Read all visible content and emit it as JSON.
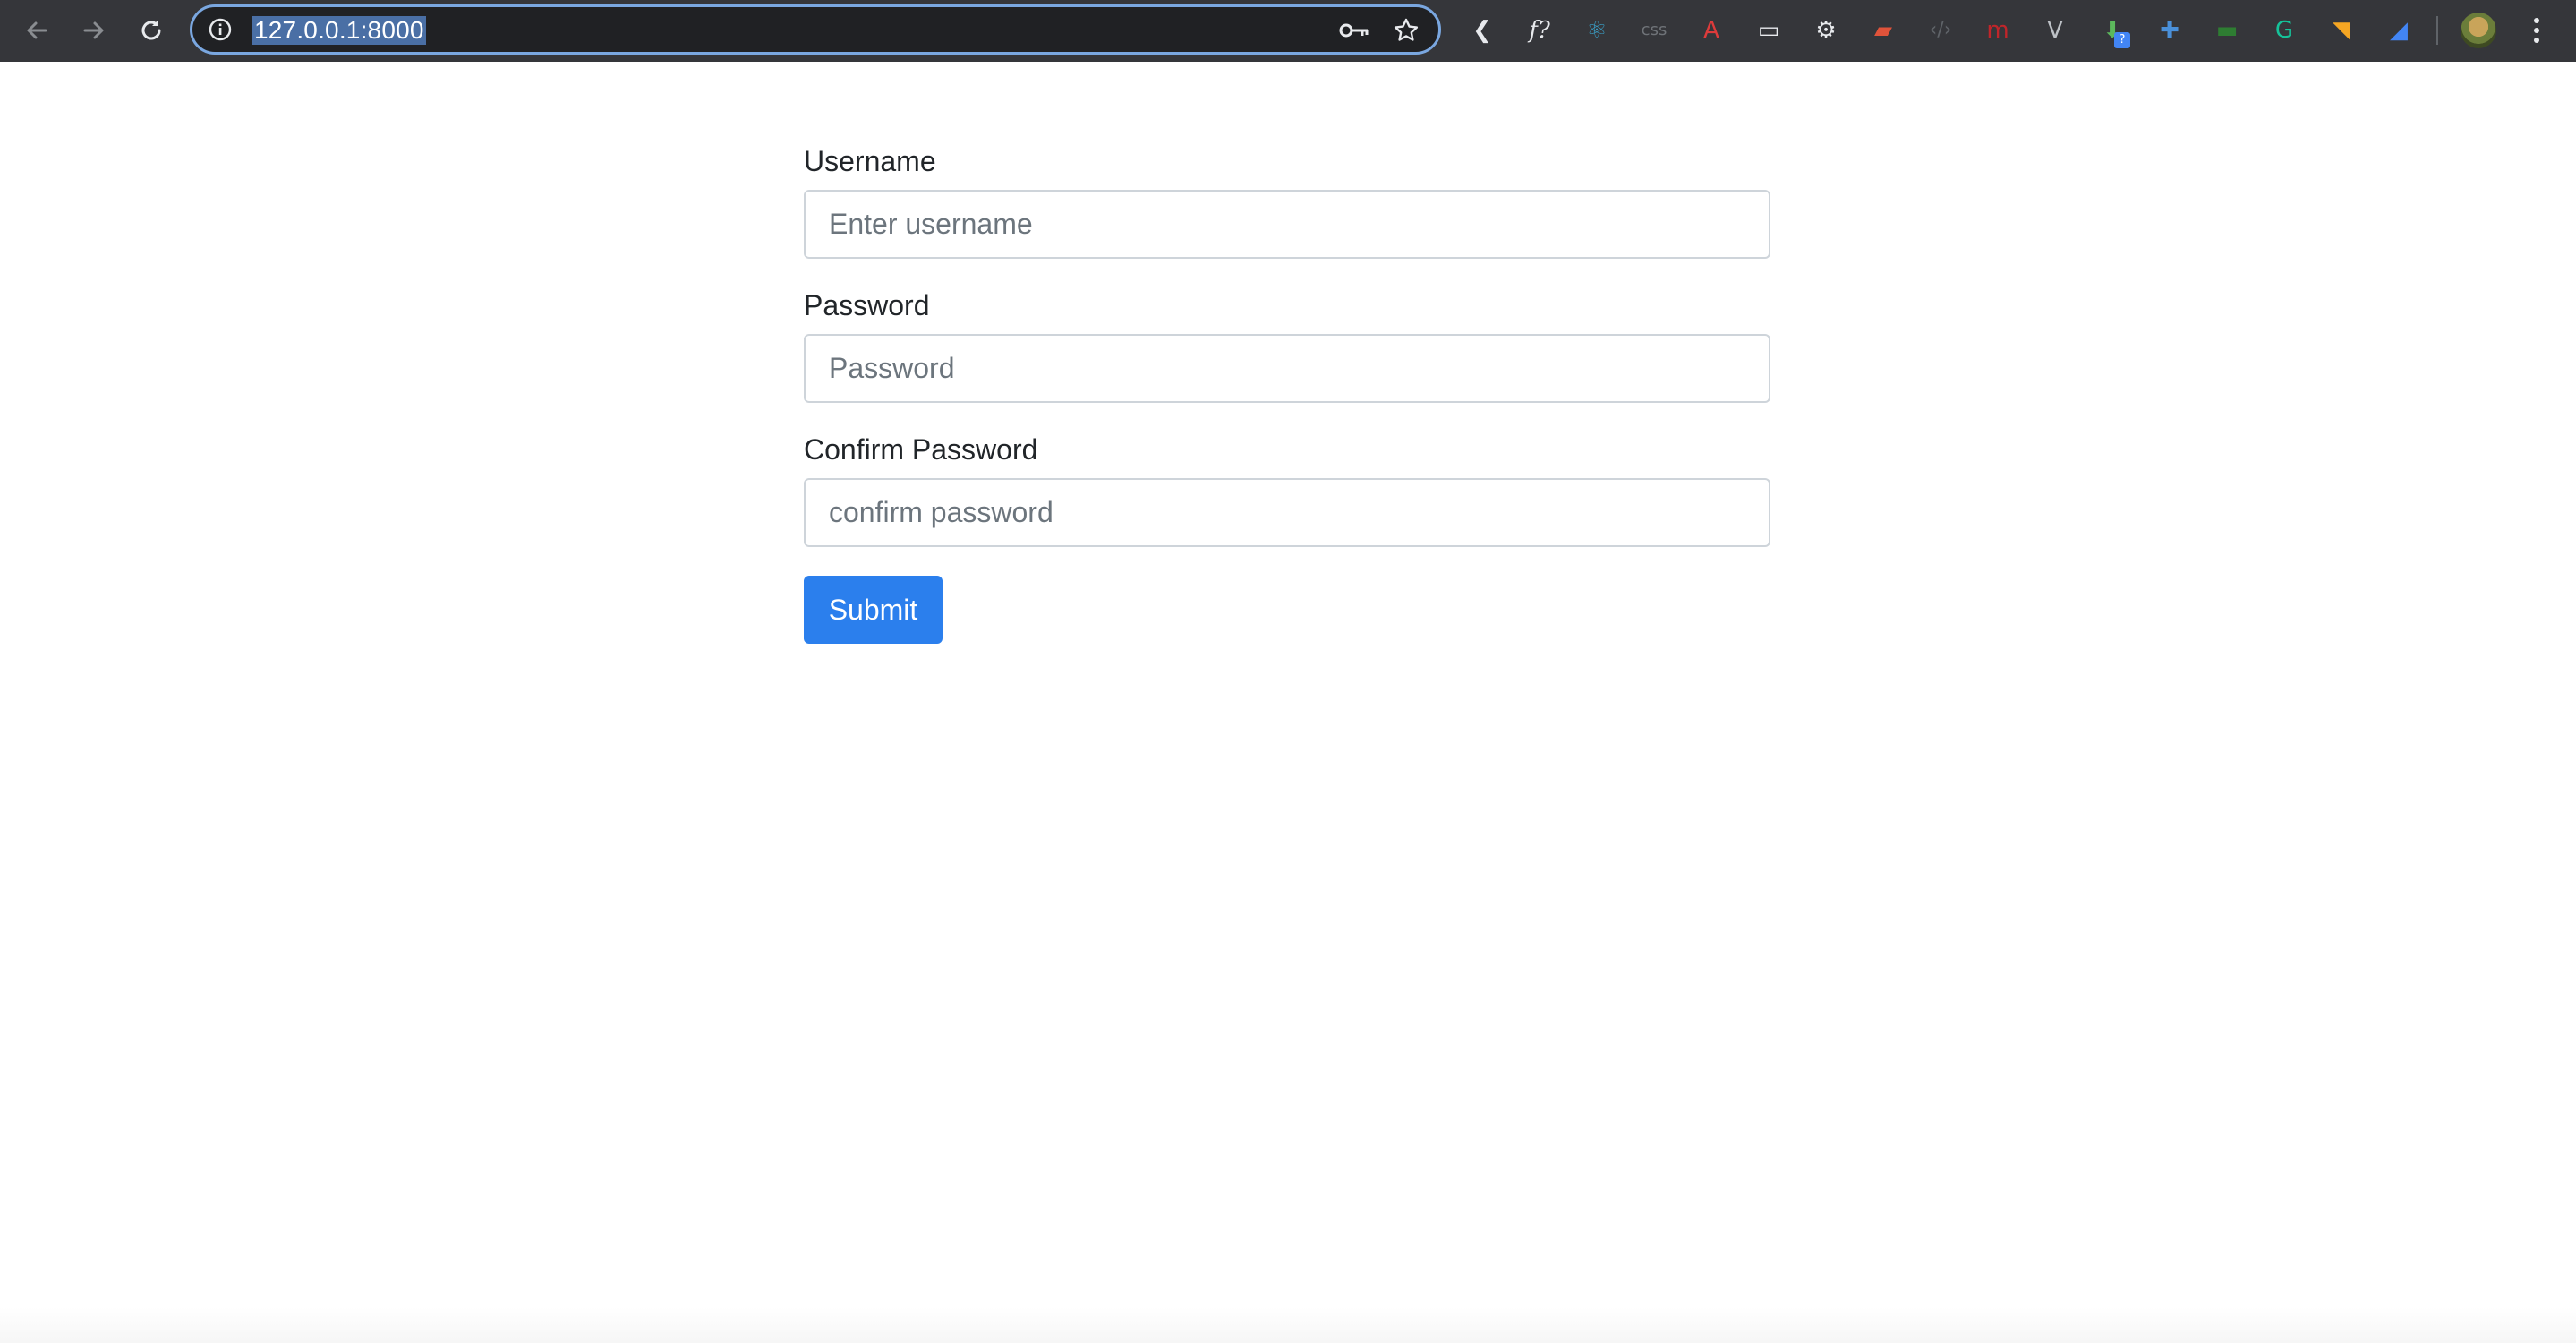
{
  "browser": {
    "url": "127.0.0.1:8000",
    "nav_icons": [
      "back-arrow-icon",
      "forward-arrow-icon",
      "reload-icon"
    ],
    "omnibox_icons": [
      "info-icon",
      "key-icon",
      "star-icon"
    ],
    "extensions": [
      {
        "name": "chevron-left-extension-icon",
        "glyph": "❮",
        "color": "#e8eaed"
      },
      {
        "name": "fx-extension-icon",
        "glyph": "f?",
        "color": "#e8eaed"
      },
      {
        "name": "atom-extension-icon",
        "glyph": "⚛",
        "color": "#3aa0c8"
      },
      {
        "name": "css-extension-icon",
        "glyph": "css",
        "color": "#6f7378"
      },
      {
        "name": "angular-extension-icon",
        "glyph": "A",
        "color": "#dd3b3b"
      },
      {
        "name": "card-extension-icon",
        "glyph": "▭",
        "color": "#e8eaed"
      },
      {
        "name": "gear-extension-icon",
        "glyph": "⚙",
        "color": "#e8eaed"
      },
      {
        "name": "red-square-extension-icon",
        "glyph": "▰",
        "color": "#e0533a"
      },
      {
        "name": "code-extension-icon",
        "glyph": "‹/›",
        "color": "#5f6368"
      },
      {
        "name": "m-extension-icon",
        "glyph": "m",
        "color": "#c0252a"
      },
      {
        "name": "v-extension-icon",
        "glyph": "V",
        "color": "#bdc1c6"
      },
      {
        "name": "download-extension-icon",
        "glyph": "⬇",
        "color": "#5cb85c"
      },
      {
        "name": "cross-extension-icon",
        "glyph": "✚",
        "color": "#4a90d9"
      },
      {
        "name": "green-bar-extension-icon",
        "glyph": "▬",
        "color": "#2e7d32"
      },
      {
        "name": "grammarly-extension-icon",
        "glyph": "G",
        "color": "#15c39a"
      },
      {
        "name": "rss-extension-icon",
        "glyph": "◥",
        "color": "#f5a623"
      },
      {
        "name": "cast-extension-icon",
        "glyph": "◢",
        "color": "#4285f4"
      }
    ],
    "download_badge": "?"
  },
  "form": {
    "username": {
      "label": "Username",
      "placeholder": "Enter username"
    },
    "password": {
      "label": "Password",
      "placeholder": "Password"
    },
    "confirm": {
      "label": "Confirm Password",
      "placeholder": "confirm password"
    },
    "submit_label": "Submit"
  }
}
